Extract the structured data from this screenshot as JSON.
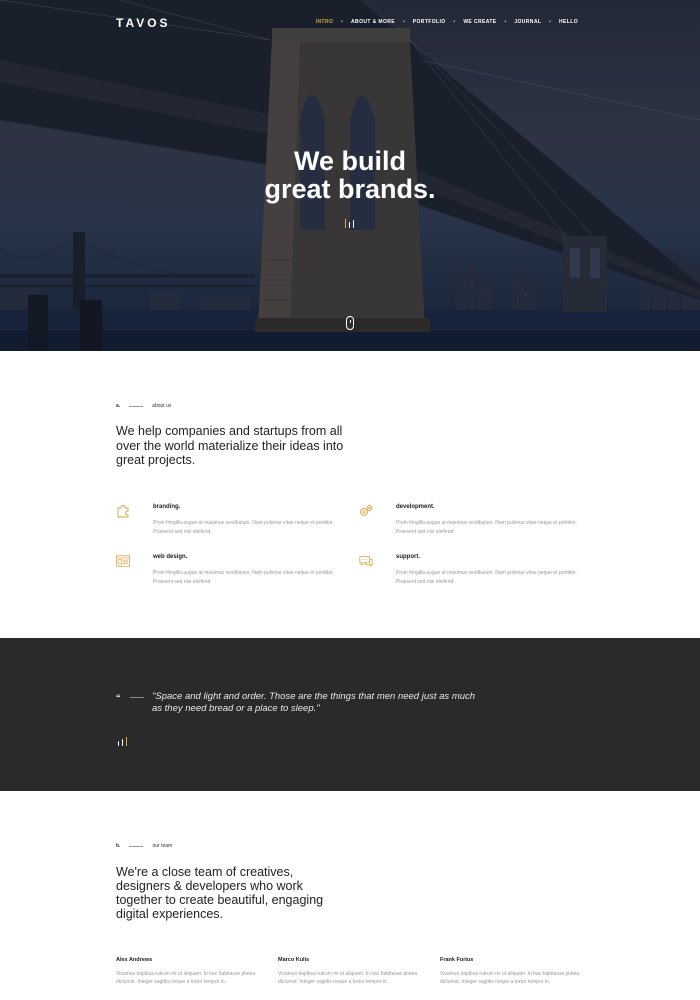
{
  "header": {
    "logo": "TAVOS",
    "nav": [
      {
        "label": "INTRO",
        "active": true
      },
      {
        "label": "ABOUT & MORE",
        "active": false
      },
      {
        "label": "PORTFOLIO",
        "active": false
      },
      {
        "label": "WE CREATE",
        "active": false
      },
      {
        "label": "JOURNAL",
        "active": false
      },
      {
        "label": "HELLO",
        "active": false
      }
    ],
    "nav_separator": "•"
  },
  "hero": {
    "title_line1": "We build",
    "title_line2": "great brands.",
    "scroll_icon": "mouse-scroll-icon"
  },
  "about": {
    "marker": "a.",
    "label": "about us",
    "heading": "We help companies and startups from all over the world materialize their ideas into great projects.",
    "services": [
      {
        "icon": "puzzle-icon",
        "title": "branding.",
        "text": "Proin fringilla augue at maximus vestibulum. Nam pulvinar vitae neque et porttitor. Praesent sed nisi eleifend."
      },
      {
        "icon": "gears-icon",
        "title": "development.",
        "text": "Proin fringilla augue at maximus vestibulum. Nam pulvinar vitae neque et porttitor. Praesent sed nisi eleifend."
      },
      {
        "icon": "browser-layout-icon",
        "title": "web design.",
        "text": "Proin fringilla augue at maximus vestibulum. Nam pulvinar vitae neque et porttitor. Praesent sed nisi eleifend."
      },
      {
        "icon": "chat-bubble-icon",
        "title": "support.",
        "text": "Proin fringilla augue at maximus vestibulum. Nam pulvinar vitae neque et porttitor. Praesent sed nisi eleifend."
      }
    ]
  },
  "quote": {
    "mark": "“",
    "text": "\"Space and light and order. Those are the things that men need just as much as they need bread or a place to sleep.\""
  },
  "team": {
    "marker": "b.",
    "label": "our team",
    "heading": "We're a close team of creatives, designers & developers who work together to create beautiful, engaging digital experiences.",
    "members": [
      {
        "name": "Alex Andrews",
        "text": "Vivamus dapibus rutrum mi ut aliquam. In hac habitasse platea dictumst. Integer sagittis neque a tortor tempor in."
      },
      {
        "name": "Marco Kulis",
        "text": "Vivamus dapibus rutrum mi ut aliquam. In hac habitasse platea dictumst. Integer sagittis neque a tortor tempor in."
      },
      {
        "name": "Frank Furius",
        "text": "Vivamus dapibus rutrum mi ut aliquam. In hac habitasse platea dictumst. Integer sagittis neque a tortor tempor in."
      }
    ]
  },
  "colors": {
    "accent": "#d9a441",
    "dark_section": "#2a2a2a",
    "muted_text": "#999999"
  }
}
